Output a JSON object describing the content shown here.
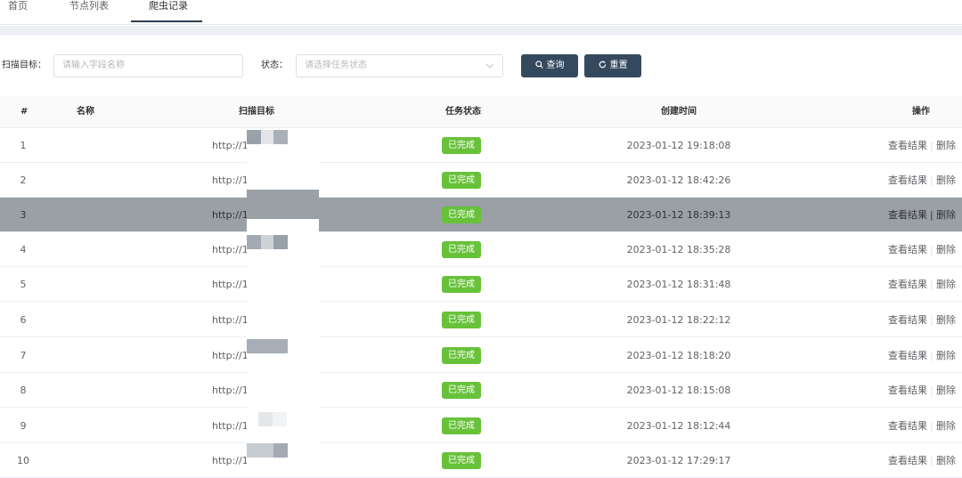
{
  "tabs": [
    {
      "label": "首页"
    },
    {
      "label": "节点列表"
    },
    {
      "label": "爬虫记录"
    }
  ],
  "filters": {
    "target_label": "扫描目标：",
    "target_placeholder": "请输入字段名称",
    "status_label": "状态：",
    "status_placeholder": "请选择任务状态",
    "query_label": "查询",
    "reset_label": "重置"
  },
  "table": {
    "headers": {
      "index": "#",
      "name": "名称",
      "target": "扫描目标",
      "status": "任务状态",
      "created": "创建时间",
      "actions": "操作"
    },
    "action_view": "查看结果",
    "action_delete": "删除",
    "rows": [
      {
        "index": "1",
        "url": "http://10",
        "status": "已完成",
        "time": "2023-01-12 19:18:08"
      },
      {
        "index": "2",
        "url": "http://10",
        "status": "已完成",
        "time": "2023-01-12 18:42:26"
      },
      {
        "index": "3",
        "url": "http://10",
        "status": "已完成",
        "time": "2023-01-12 18:39:13"
      },
      {
        "index": "4",
        "url": "http://10",
        "status": "已完成",
        "time": "2023-01-12 18:35:28"
      },
      {
        "index": "5",
        "url": "http://10",
        "status": "已完成",
        "time": "2023-01-12 18:31:48"
      },
      {
        "index": "6",
        "url": "http://10",
        "status": "已完成",
        "time": "2023-01-12 18:22:12"
      },
      {
        "index": "7",
        "url": "http://10",
        "status": "已完成",
        "time": "2023-01-12 18:18:20"
      },
      {
        "index": "8",
        "url": "http://10",
        "status": "已完成",
        "time": "2023-01-12 18:15:08"
      },
      {
        "index": "9",
        "url": "http://10",
        "status": "已完成",
        "time": "2023-01-12 18:12:44"
      },
      {
        "index": "10",
        "url": "http://10",
        "status": "已完成",
        "time": "2023-01-12 17:29:17"
      }
    ]
  },
  "colors": {
    "primary": "#35495e",
    "success": "#67c23a",
    "highlight_row": "#9aa0a6"
  }
}
